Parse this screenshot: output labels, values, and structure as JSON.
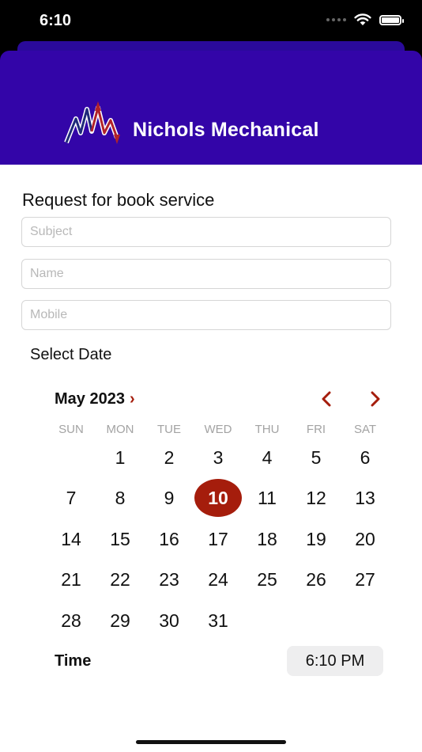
{
  "status_bar": {
    "time": "6:10"
  },
  "header": {
    "brand_name": "Nichols Mechanical"
  },
  "form": {
    "title": "Request for book service",
    "subject_placeholder": "Subject",
    "name_placeholder": "Name",
    "mobile_placeholder": "Mobile",
    "select_date_label": "Select Date"
  },
  "calendar": {
    "month_label": "May 2023",
    "weekdays": [
      "SUN",
      "MON",
      "TUE",
      "WED",
      "THU",
      "FRI",
      "SAT"
    ],
    "first_weekday_index": 1,
    "days_in_month": 31,
    "selected_day": 10
  },
  "time": {
    "label": "Time",
    "value": "6:10 PM"
  },
  "colors": {
    "header_bg": "#3305a8",
    "accent": "#a51d0c",
    "weekday_text": "#a3a3a3"
  },
  "icons": [
    "wifi-icon",
    "battery-icon",
    "chevron-right-icon",
    "chevron-left-icon",
    "logo-mark"
  ]
}
